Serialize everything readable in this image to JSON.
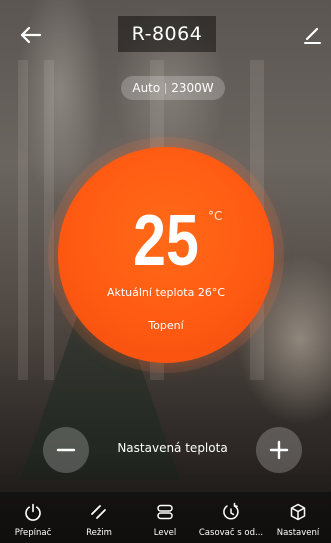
{
  "header": {
    "title": "R-8064"
  },
  "mode_pill": {
    "mode": "Auto",
    "power": "2300W"
  },
  "dial": {
    "temperature": "25",
    "unit": "°C",
    "current_label": "Aktuální teplota 26°C",
    "status": "Topení"
  },
  "set_temp": {
    "label": "Nastavená teplota"
  },
  "bottom_nav": [
    {
      "label": "Přepínač",
      "icon": "power-icon"
    },
    {
      "label": "Režim",
      "icon": "mode-icon"
    },
    {
      "label": "Level",
      "icon": "level-icon"
    },
    {
      "label": "Časovač s od...",
      "icon": "timer-icon"
    },
    {
      "label": "Nastavení",
      "icon": "settings-cube-icon"
    }
  ],
  "colors": {
    "dial": "#ff5a12",
    "text": "#ffffff"
  }
}
